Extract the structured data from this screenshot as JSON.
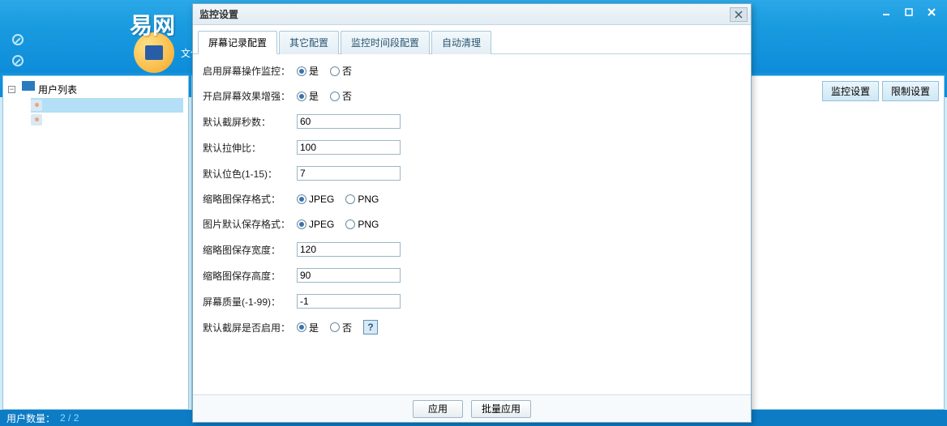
{
  "mainWindow": {
    "logoFragment": "易网",
    "fileMenu": "文件"
  },
  "sidebar": {
    "rootLabel": "用户列表"
  },
  "contentTabs": {
    "monitorSettings": "监控设置",
    "restrictSettings": "限制设置"
  },
  "statusBar": {
    "label": "用户数量：",
    "value": "2 / 2"
  },
  "modal": {
    "title": "监控设置",
    "tabs": {
      "screenRecord": "屏幕记录配置",
      "other": "其它配置",
      "timeRange": "监控时间段配置",
      "autoClean": "自动清理"
    },
    "form": {
      "enableScreenMonitor": {
        "label": "启用屏幕操作监控：",
        "yes": "是",
        "no": "否"
      },
      "enableScreenEnhance": {
        "label": "开启屏幕效果增强：",
        "yes": "是",
        "no": "否"
      },
      "defaultCaptureSec": {
        "label": "默认截屏秒数：",
        "value": "60"
      },
      "defaultStretch": {
        "label": "默认拉伸比：",
        "value": "100"
      },
      "defaultBitColor": {
        "label": "默认位色(1-15)：",
        "value": "7"
      },
      "thumbFormat": {
        "label": "缩略图保存格式：",
        "jpeg": "JPEG",
        "png": "PNG"
      },
      "imageFormat": {
        "label": "图片默认保存格式：",
        "jpeg": "JPEG",
        "png": "PNG"
      },
      "thumbWidth": {
        "label": "缩略图保存宽度：",
        "value": "120"
      },
      "thumbHeight": {
        "label": "缩略图保存高度：",
        "value": "90"
      },
      "screenQuality": {
        "label": "屏幕质量(-1-99)：",
        "value": "-1"
      },
      "defaultCaptureEnabled": {
        "label": "默认截屏是否启用：",
        "yes": "是",
        "no": "否",
        "help": "?"
      }
    },
    "buttons": {
      "apply": "应用",
      "batchApply": "批量应用"
    }
  }
}
